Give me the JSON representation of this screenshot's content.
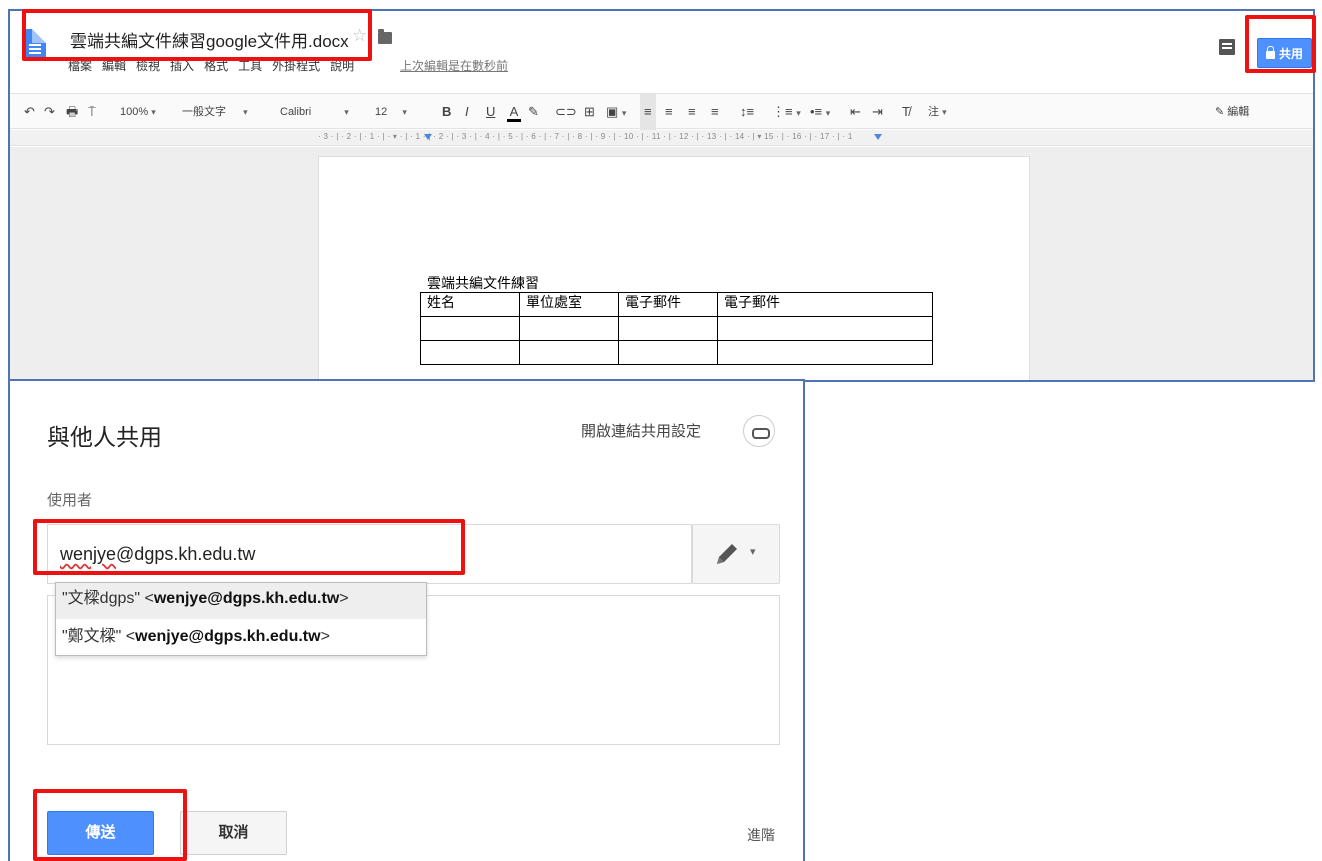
{
  "app": {
    "doc_title": "雲端共編文件練習google文件用.docx",
    "menu": [
      "檔案",
      "編輯",
      "檢視",
      "插入",
      "格式",
      "工具",
      "外掛程式",
      "說明"
    ],
    "last_edit": "上次編輯是在數秒前",
    "share_label": "共用"
  },
  "toolbar": {
    "zoom": "100%",
    "style": "一般文字",
    "font": "Calibri",
    "size": "12",
    "bold": "B",
    "italic": "I",
    "underline": "U",
    "text_color": "A",
    "clear_format": "T̸",
    "comment": "注",
    "mode": "編輯"
  },
  "ruler_text": "· 3 · | · 2 · | · 1 · | · ▾ · | · 1 · | · 2 · | · 3 · | · 4 · | · 5 · | · 6 · | · 7 · | · 8 · | · 9 · | · 10 · | · 11 · | · 12 · | · 13 · | · 14 · | ▾ 15 · | · 16 · | · 17 · | · 1",
  "document": {
    "heading": "雲端共編文件練習",
    "table_headers": [
      "姓名",
      "單位處室",
      "電子郵件",
      "電子郵件"
    ],
    "table_rows": [
      [
        "",
        "",
        "",
        ""
      ],
      [
        "",
        "",
        "",
        ""
      ]
    ]
  },
  "dialog": {
    "title": "與他人共用",
    "link_settings": "開啟連結共用設定",
    "people_label": "使用者",
    "input_value_underlined": "wenjye",
    "input_value_rest": "@dgps.kh.edu.tw",
    "suggestions": [
      {
        "name": "\"文樑dgps\" <",
        "email": "wenjye@dgps.kh.edu.tw",
        "end": ">"
      },
      {
        "name": "\"鄭文樑\" <",
        "email": "wenjye@dgps.kh.edu.tw",
        "end": ">"
      }
    ],
    "send": "傳送",
    "cancel": "取消",
    "advanced": "進階"
  },
  "colors": {
    "accent_blue": "#4d90fe",
    "highlight_red": "#ee1111",
    "panel_border": "#4f74b3"
  }
}
